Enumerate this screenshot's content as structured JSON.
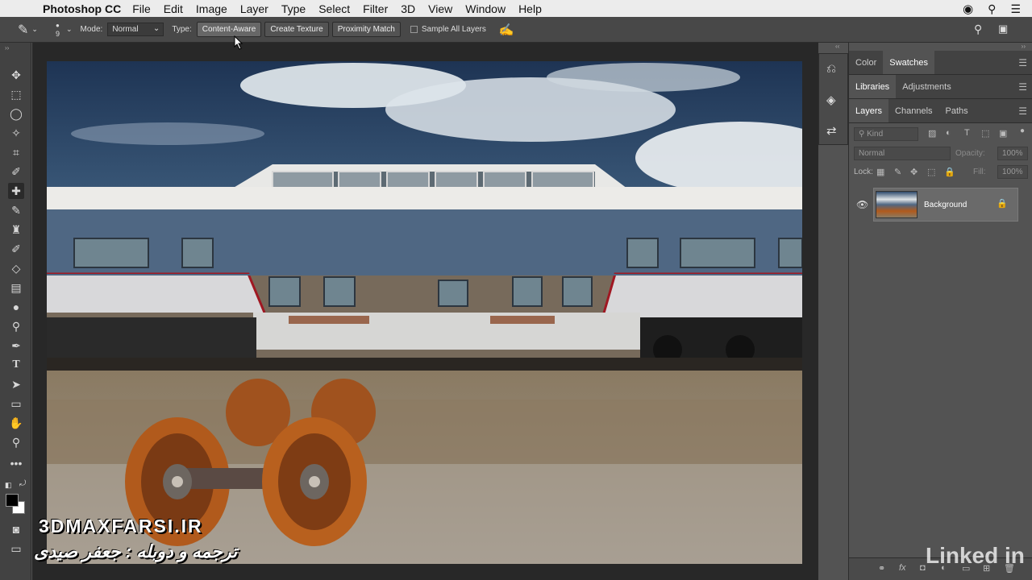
{
  "menubar": {
    "app_name": "Photoshop CC",
    "items": [
      "File",
      "Edit",
      "Image",
      "Layer",
      "Type",
      "Select",
      "Filter",
      "3D",
      "View",
      "Window",
      "Help"
    ]
  },
  "options": {
    "brush_size": "9",
    "mode_label": "Mode:",
    "mode_value": "Normal",
    "type_label": "Type:",
    "type_buttons": [
      "Content-Aware",
      "Create Texture",
      "Proximity Match"
    ],
    "sample_all_layers": "Sample All Layers"
  },
  "panels": {
    "group1_tabs": [
      "Color",
      "Swatches"
    ],
    "group2_tabs": [
      "Libraries",
      "Adjustments"
    ],
    "group3_tabs": [
      "Layers",
      "Channels",
      "Paths"
    ],
    "filter_kind": "Kind",
    "blend_mode": "Normal",
    "opacity_label": "Opacity:",
    "opacity_value": "100%",
    "lock_label": "Lock:",
    "fill_label": "Fill:",
    "fill_value": "100%",
    "layer_name": "Background"
  },
  "overlays": {
    "watermark": "3DMAXFARSI.IR",
    "credit": "ترجمه و دوبله : جعفر صیدی",
    "brand": "Linked in"
  },
  "colors": {
    "menubar": "#ececec",
    "panel": "#535353",
    "toolbar": "#424242",
    "doc_bg": "#282828"
  }
}
